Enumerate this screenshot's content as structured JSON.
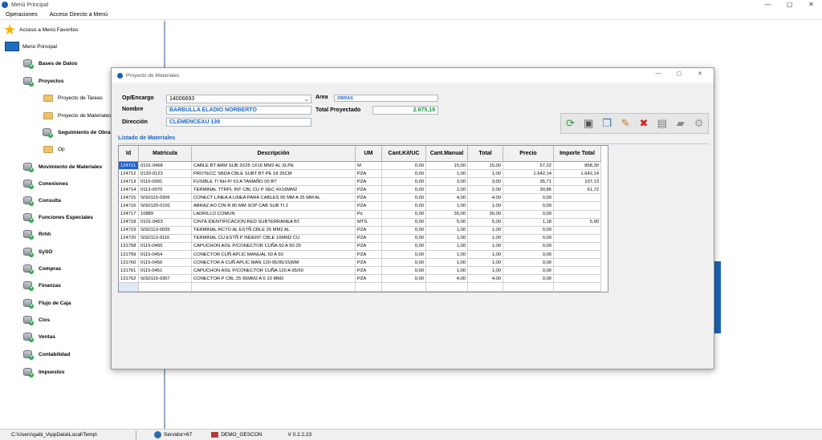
{
  "app": {
    "title": "Menú Principal",
    "window_controls": [
      "—",
      "▢",
      "✕"
    ]
  },
  "menubar": [
    "Operaciones",
    "Acceso Directo a Menú"
  ],
  "sidebar": {
    "favorites": "Acceso a Menú Favoritos",
    "main_menu": "Menú Principal",
    "items": [
      {
        "label": "Bases de Datos"
      },
      {
        "label": "Proyectos"
      },
      {
        "label": "Proyecto de Tareas"
      },
      {
        "label": "Proyecto de Materiales"
      },
      {
        "label": "Seguimiento de Obras"
      },
      {
        "label": "Op"
      },
      {
        "label": "Movimiento de Materiales"
      },
      {
        "label": "Conexiones"
      },
      {
        "label": "Consulta"
      },
      {
        "label": "Funciones Especiales"
      },
      {
        "label": "Rrhh"
      },
      {
        "label": "SySO"
      },
      {
        "label": "Compras"
      },
      {
        "label": "Finanzas"
      },
      {
        "label": "Flujo de Caja"
      },
      {
        "label": "Cios"
      },
      {
        "label": "Ventas"
      },
      {
        "label": "Contabilidad"
      },
      {
        "label": "Impuestos"
      }
    ]
  },
  "statusbar": {
    "path": "C:\\Users\\gabi_\\AppData\\Local\\Temp\\",
    "server": "Servidor>67",
    "db": "DEMO_GESCON",
    "version": "V 0.2.2.23"
  },
  "dialog": {
    "title": "Proyecto de Materiales",
    "op_label": "Op/Encargo",
    "op_value": "14006693",
    "area_label": "Area",
    "area_value": "OBRAS",
    "nombre_label": "Nombre",
    "nombre_value": "BARBULLA ELADIO NORBERTO",
    "total_label": "Total Proyectado",
    "total_value": "2.675,19",
    "direccion_label": "Dirección",
    "direccion_value": "CLEMENCEAU 139",
    "section_title": "Listado de Materiales",
    "toolbar_icons": [
      "refresh-add-icon",
      "save-icon",
      "copy-icon",
      "edit-icon",
      "delete-icon",
      "paste-icon",
      "eraser-icon",
      "settings-icon"
    ],
    "columns": [
      "Id",
      "Matrícula",
      "Descripción",
      "UM",
      "Cant.Kit/UC",
      "Cant.Manual",
      "Total",
      "Precio",
      "Importe Total"
    ],
    "rows": [
      [
        "124711",
        "0101-0468",
        "CABLE BT ARM SUB 3X25 1X16 MM2 AL XLPE",
        "M",
        "0,00",
        "15,00",
        "15,00",
        "57,22",
        "858,30"
      ],
      [
        "124712",
        "0120-0123",
        "PROTECC SBDA CBLE SUBT BT PE 18 25CM",
        "PZA",
        "0,00",
        "1,00",
        "1,00",
        "1.642,14",
        "1.642,14"
      ],
      [
        "124713",
        "0110-0091",
        "FUSIBLE TI NH P/ 63 A TAMAÑO 00 BT",
        "PZA",
        "0,00",
        "3,00",
        "3,00",
        "35,71",
        "107,13"
      ],
      [
        "124714",
        "0113-0070",
        "TERMINAL TTRPL INT CBL CU P SEC 4X16MM2",
        "PZA",
        "0,00",
        "2,00",
        "2,00",
        "30,86",
        "61,72"
      ],
      [
        "124715",
        "SIS0115-0306",
        "CONECT LINEA A LINEA PARA CABLES 95 MM A 25 MM AL",
        "PZA",
        "0,00",
        "4,00",
        "4,00",
        "0,00",
        ""
      ],
      [
        "124716",
        "SIS0120-0191",
        "ABRAZ AO CIN R 80 MM SOP CAB SUB TI 2",
        "PZA",
        "0,00",
        "1,00",
        "1,00",
        "0,00",
        ""
      ],
      [
        "124717",
        "10889",
        "LADRILLO COMUN",
        "Pz",
        "0,00",
        "35,00",
        "35,00",
        "0,00",
        ""
      ],
      [
        "124718",
        "0101-0453",
        "CINTA IDENTIFICACION RED SUBTERRANEA BT.",
        "MTS.",
        "0,00",
        "5,00",
        "5,00",
        "1,18",
        "5,90"
      ],
      [
        "124719",
        "SIS0113-0035",
        "TERMINAL RCTO AL ESTÑ  CBLE 25 MM2 AL",
        "PZA",
        "0,00",
        "1,00",
        "1,00",
        "0,00",
        ""
      ],
      [
        "124720",
        "SIS0113-0116",
        "TERMINAL CU ESTÑ P INDENT CBLE 16MM2 CU",
        "PZA",
        "0,00",
        "1,00",
        "1,00",
        "0,00",
        ""
      ],
      [
        "131758",
        "0115-0450",
        "CAPUCHON AISL P/CONECTOR CUÑA 50 A 50-25",
        "PZA",
        "0,00",
        "1,00",
        "1,00",
        "0,00",
        ""
      ],
      [
        "131759",
        "0115-0454",
        "CONECTOR CUÑ APLIC MANUAL 50 A 50",
        "PZA",
        "0,00",
        "1,00",
        "1,00",
        "0,00",
        ""
      ],
      [
        "131760",
        "0115-0456",
        "CONECTOR A CUÑ APLIC MAN 120-95/95/15|MM",
        "PZA",
        "0,00",
        "1,00",
        "1,00",
        "0,00",
        ""
      ],
      [
        "131761",
        "0115-0451",
        "CAPUCHON AISL P/CONECTOR CUÑA 120 A 95/50",
        "PZA",
        "0,00",
        "1,00",
        "1,00",
        "0,00",
        ""
      ],
      [
        "131762",
        "SIS0115-0307",
        "CONECTOR P CBL 25 95MM2 A 6 10 MM2",
        "PZA",
        "0,00",
        "4,00",
        "4,00",
        "0,00",
        ""
      ]
    ]
  }
}
